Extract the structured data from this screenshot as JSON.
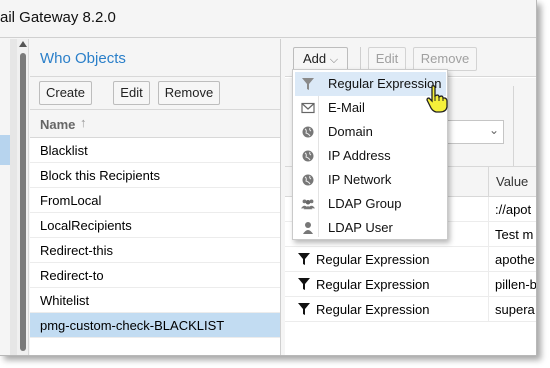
{
  "window": {
    "title": "ail Gateway 8.2.0"
  },
  "left_panel": {
    "title": "Who Objects",
    "toolbar": {
      "create": "Create",
      "edit": "Edit",
      "remove": "Remove"
    },
    "column_header": "Name",
    "sort_indicator": "↑",
    "items": [
      "Blacklist",
      "Block this Recipients",
      "FromLocal",
      "LocalRecipients",
      "Redirect-this",
      "Redirect-to",
      "Whitelist",
      "pmg-custom-check-BLACKLIST"
    ],
    "selected_item": "pmg-custom-check-BLACKLIST"
  },
  "right_panel": {
    "toolbar": {
      "add": "Add",
      "edit": "Edit",
      "remove": "Remove"
    },
    "value_column": "Value",
    "rows": [
      {
        "type": "",
        "value": "://apot"
      },
      {
        "type": "",
        "value": "Test m"
      },
      {
        "type": "Regular Expression",
        "value": "apothe"
      },
      {
        "type": "Regular Expression",
        "value": "pillen-b"
      },
      {
        "type": "Regular Expression",
        "value": "supera"
      }
    ]
  },
  "add_menu": {
    "items": [
      {
        "label": "Regular Expression",
        "icon": "filter-icon"
      },
      {
        "label": "E-Mail",
        "icon": "envelope-icon"
      },
      {
        "label": "Domain",
        "icon": "globe-icon"
      },
      {
        "label": "IP Address",
        "icon": "globe-icon"
      },
      {
        "label": "IP Network",
        "icon": "globe-icon"
      },
      {
        "label": "LDAP Group",
        "icon": "users-icon"
      },
      {
        "label": "LDAP User",
        "icon": "user-icon"
      }
    ],
    "highlighted": "Regular Expression"
  },
  "colors": {
    "accent": "#2a7fc9",
    "selection": "#c2dcf2",
    "menu_highlight": "#dbe9f7"
  }
}
